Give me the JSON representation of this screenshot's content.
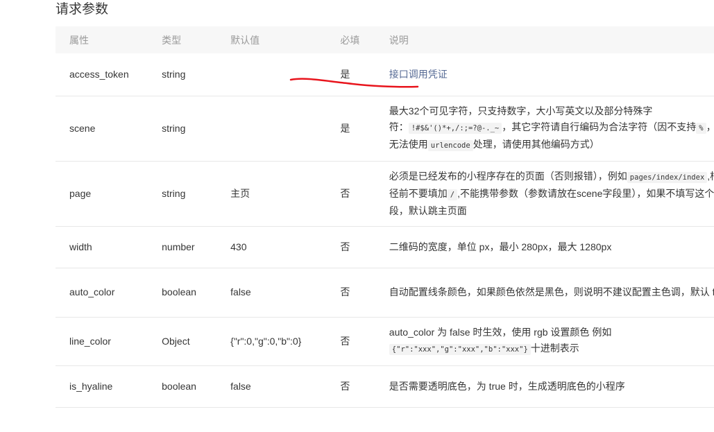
{
  "section_title": "请求参数",
  "headers": [
    "属性",
    "类型",
    "默认值",
    "必填",
    "说明"
  ],
  "rows": [
    {
      "name": "access_token",
      "type": "string",
      "default": "",
      "required": "是",
      "desc": [
        {
          "t": "link",
          "v": "接口调用凭证"
        }
      ]
    },
    {
      "name": "scene",
      "type": "string",
      "default": "",
      "required": "是",
      "desc": [
        {
          "t": "text",
          "v": "最大32个可见字符，只支持数字，大小写英文以及部分特殊字符："
        },
        {
          "t": "code",
          "v": "!#$&'()*+,/:;=?@-._~"
        },
        {
          "t": "text",
          "v": "，其它字符请自行编码为合法字符（因不支持"
        },
        {
          "t": "code",
          "v": "%"
        },
        {
          "t": "text",
          "v": "，中文无法使用"
        },
        {
          "t": "code",
          "v": "urlencode"
        },
        {
          "t": "text",
          "v": "处理，请使用其他编码方式）"
        }
      ]
    },
    {
      "name": "page",
      "type": "string",
      "default": "主页",
      "required": "否",
      "desc": [
        {
          "t": "text",
          "v": "必须是已经发布的小程序存在的页面（否则报错），例如"
        },
        {
          "t": "code",
          "v": "pages/index/index"
        },
        {
          "t": "text",
          "v": ",根路径前不要填加"
        },
        {
          "t": "code",
          "v": "/"
        },
        {
          "t": "text",
          "v": ",不能携带参数（参数请放在scene字段里），如果不填写这个字段，默认跳主页面"
        }
      ]
    },
    {
      "name": "width",
      "type": "number",
      "default": "430",
      "required": "否",
      "desc": [
        {
          "t": "text",
          "v": "二维码的宽度，单位 px，最小 280px，最大 1280px"
        }
      ]
    },
    {
      "name": "auto_color",
      "type": "boolean",
      "default": "false",
      "required": "否",
      "desc": [
        {
          "t": "text",
          "v": "自动配置线条颜色，如果颜色依然是黑色，则说明不建议配置主色调，默认 false"
        }
      ]
    },
    {
      "name": "line_color",
      "type": "Object",
      "default": "{\"r\":0,\"g\":0,\"b\":0}",
      "required": "否",
      "desc": [
        {
          "t": "text",
          "v": "auto_color 为 false 时生效，使用 rgb 设置颜色 例如"
        },
        {
          "t": "code",
          "v": "{\"r\":\"xxx\",\"g\":\"xxx\",\"b\":\"xxx\"}"
        },
        {
          "t": "text",
          "v": "十进制表示"
        }
      ]
    },
    {
      "name": "is_hyaline",
      "type": "boolean",
      "default": "false",
      "required": "否",
      "desc": [
        {
          "t": "text",
          "v": "是否需要透明底色，为 true 时，生成透明底色的小程序"
        }
      ]
    }
  ],
  "colors": {
    "annotation": "#e8141c",
    "link": "#576b95",
    "header_bg": "#f7f7f7"
  }
}
